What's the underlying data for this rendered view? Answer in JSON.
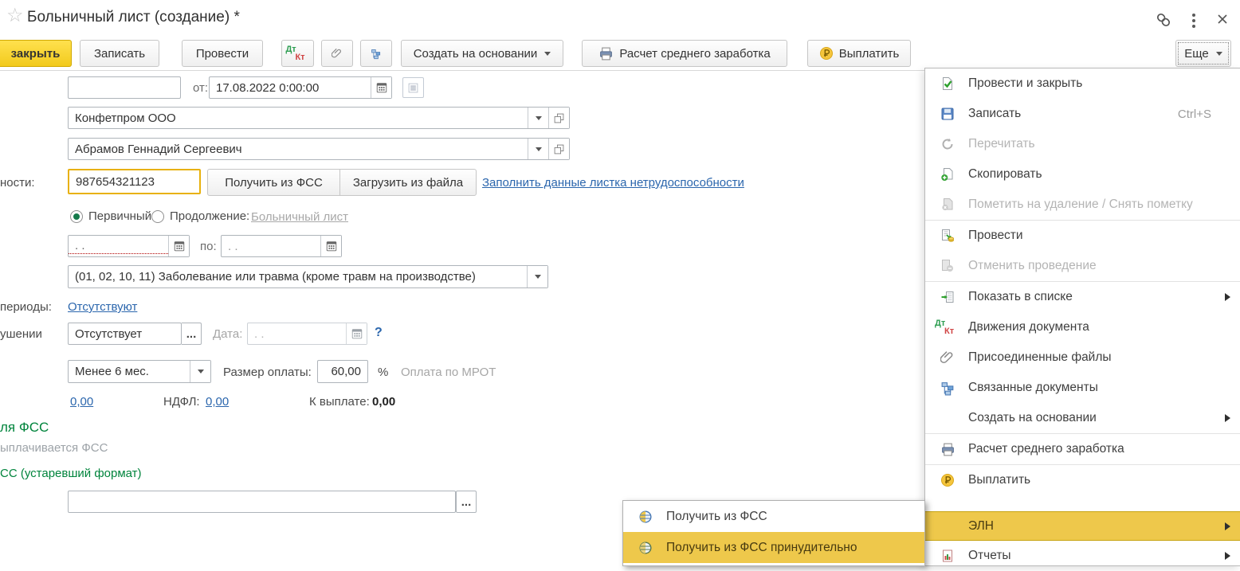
{
  "window": {
    "title": "Больничный лист (создание) *"
  },
  "toolbar": {
    "close_label": "закрыть",
    "save_label": "Записать",
    "post_label": "Провести",
    "create_based_label": "Создать на основании",
    "avg_earnings_label": "Расчет среднего заработка",
    "pay_label": "Выплатить",
    "more_label": "Еще"
  },
  "icons": {
    "dt": "Дт",
    "kt": "Кт"
  },
  "form": {
    "date_label": "от:",
    "date_value": "17.08.2022 0:00:00",
    "organization": "Конфетпром ООО",
    "employee": "Абрамов Геннадий Сергеевич",
    "ln_label": "ности:",
    "ln_number": "987654321123",
    "get_fss_label": "Получить из ФСС",
    "load_file_label": "Загрузить из файла",
    "fill_link": "Заполнить данные листка нетрудоспособности",
    "radio_primary": "Первичный",
    "radio_continuation": "Продолжение:",
    "continuation_link": "Больничный лист",
    "empty_date": ". .",
    "to_label": "по:",
    "cause_value": "(01, 02, 10, 11) Заболевание или травма (кроме травм на производстве)",
    "periods_label": "периоды:",
    "periods_value": "Отсутствуют",
    "violation_label": "ушении",
    "violation_value": "Отсутствует",
    "ellipsis": "...",
    "violation_date_label": "Дата:",
    "help": "?",
    "experience_value": "Менее 6 мес.",
    "pay_size_label": "Размер оплаты:",
    "pay_size_value": "60,00",
    "percent": "%",
    "mrot_label": "Оплата по МРОТ",
    "accrued": "0,00",
    "ndfl_label": "НДФЛ:",
    "ndfl_value": "0,00",
    "to_pay_label": "К выплате:",
    "to_pay_value": "0,00",
    "fss_section": "ля ФСС",
    "fss_paid": "ыплачивается ФСС",
    "fss_registry": "СС (устаревший формат)"
  },
  "menu": {
    "items": [
      {
        "label": "Провести и закрыть",
        "icon": "post-and-close"
      },
      {
        "label": "Записать",
        "icon": "save",
        "shortcut": "Ctrl+S"
      },
      {
        "label": "Перечитать",
        "icon": "refresh",
        "disabled": true
      },
      {
        "label": "Скопировать",
        "icon": "copy"
      },
      {
        "label": "Пометить на удаление / Снять пометку",
        "icon": "mark-delete",
        "disabled": true
      },
      {
        "label": "Провести",
        "icon": "post"
      },
      {
        "label": "Отменить проведение",
        "icon": "unpost",
        "disabled": true
      },
      {
        "label": "Показать в списке",
        "icon": "show-in-list",
        "submenu": true
      },
      {
        "label": "Движения документа",
        "icon": "dtkt"
      },
      {
        "label": "Присоединенные файлы",
        "icon": "paperclip"
      },
      {
        "label": "Связанные документы",
        "icon": "linked-docs"
      },
      {
        "label": "Создать на основании",
        "submenu": true
      },
      {
        "label": "Расчет среднего заработка",
        "icon": "printer"
      },
      {
        "label": "Выплатить",
        "icon": "ruble"
      },
      {
        "label": "ЭЛН",
        "submenu": true,
        "highlighted": true
      },
      {
        "label": "Отчеты",
        "icon": "report",
        "submenu": true
      }
    ]
  },
  "submenu": {
    "items": [
      {
        "label": "Получить из ФСС",
        "icon": "globe"
      },
      {
        "label": "Получить из ФСС принудительно",
        "icon": "globe",
        "highlighted": true
      }
    ]
  },
  "colors": {
    "accent_yellow": "#f2ca1d",
    "menu_highlight": "#eec84b",
    "link_blue": "#2b66ad",
    "section_green": "#00843c",
    "focus_border": "#e8b10d"
  }
}
